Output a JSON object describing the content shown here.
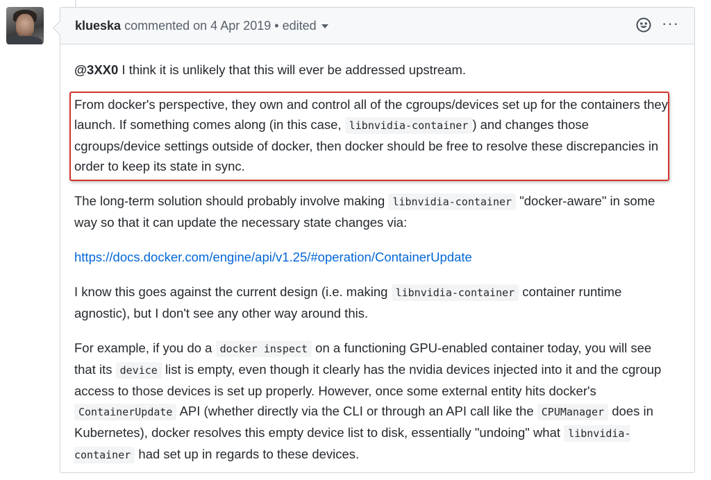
{
  "comment": {
    "author": "klueska",
    "action": "commented on",
    "date": "4 Apr 2019",
    "separator": "•",
    "edited_label": "edited",
    "more_label": "···",
    "mention": "@3XX0",
    "p1_text": " I think it is unlikely that this will ever be addressed upstream.",
    "p2": {
      "t1": "From docker's perspective, they own and control all of the cgroups/devices set up for the containers they launch. If something comes along (in this case, ",
      "c1": "libnvidia-container",
      "t2": ") and changes those cgroups/device settings outside of docker, then docker should be free to resolve these discrepancies in order to keep its state in sync."
    },
    "p3": {
      "t1": "The long-term solution should probably involve making ",
      "c1": "libnvidia-container",
      "t2": " \"docker-aware\" in some way so that it can update the necessary state changes via:"
    },
    "p4_link": "https://docs.docker.com/engine/api/v1.25/#operation/ContainerUpdate",
    "p5": {
      "t1": "I know this goes against the current design (i.e. making ",
      "c1": "libnvidia-container",
      "t2": " container runtime agnostic), but I don't see any other way around this."
    },
    "p6": {
      "t1": "For example, if you do a ",
      "c1": "docker inspect",
      "t2": " on a functioning GPU-enabled container today, you will see that its ",
      "c2": "device",
      "t3": " list is empty, even though it clearly has the nvidia devices injected into it and the cgroup access to those devices is set up properly. However, once some external entity hits docker's ",
      "c3": "ContainerUpdate",
      "t4": " API (whether directly via the CLI or through an API call like the ",
      "c4": "CPUManager",
      "t5": " does in Kubernetes), docker resolves this empty device list to disk, essentially \"undoing\" what ",
      "c5": "libnvidia-container",
      "t6": " had set up in regards to these devices."
    }
  },
  "icons": {
    "avatar": "user-avatar-photo",
    "reaction": "smiley-face-icon",
    "more": "kebab-horizontal-icon",
    "dropdown": "caret-down-icon"
  },
  "colors": {
    "link": "#0366d6",
    "highlight_border": "#d0342c",
    "header_bg": "#f6f8fa"
  }
}
